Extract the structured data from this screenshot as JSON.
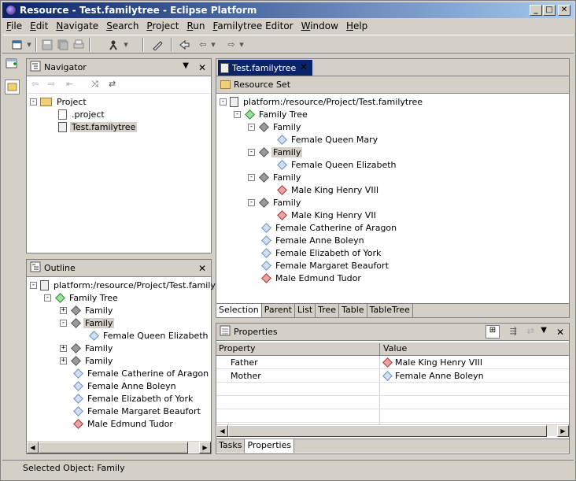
{
  "window": {
    "title": "Resource - Test.familytree - Eclipse Platform",
    "min": "_",
    "max": "□",
    "close": "✕"
  },
  "menu": [
    "File",
    "Edit",
    "Navigate",
    "Search",
    "Project",
    "Run",
    "Familytree Editor",
    "Window",
    "Help"
  ],
  "navigator": {
    "title": "Navigator",
    "items": [
      {
        "label": "Project"
      },
      {
        "label": ".project"
      },
      {
        "label": "Test.familytree"
      }
    ]
  },
  "outline": {
    "title": "Outline",
    "items": [
      {
        "label": "platform:/resource/Project/Test.familytr"
      },
      {
        "label": "Family Tree"
      },
      {
        "label": "Family"
      },
      {
        "label": "Family"
      },
      {
        "label": "Female Queen Elizabeth"
      },
      {
        "label": "Family"
      },
      {
        "label": "Family"
      },
      {
        "label": "Female Catherine of Aragon"
      },
      {
        "label": "Female Anne Boleyn"
      },
      {
        "label": "Female Elizabeth of York"
      },
      {
        "label": "Female Margaret Beaufort"
      },
      {
        "label": "Male Edmund Tudor"
      }
    ]
  },
  "editor": {
    "tab": "Test.familytree",
    "header": "Resource Set",
    "items": [
      {
        "label": "platform:/resource/Project/Test.familytree"
      },
      {
        "label": "Family Tree"
      },
      {
        "label": "Family"
      },
      {
        "label": "Female Queen Mary"
      },
      {
        "label": "Family"
      },
      {
        "label": "Female Queen Elizabeth"
      },
      {
        "label": "Family"
      },
      {
        "label": "Male King Henry VIII"
      },
      {
        "label": "Family"
      },
      {
        "label": "Male King Henry VII"
      },
      {
        "label": "Female Catherine of Aragon"
      },
      {
        "label": "Female Anne Boleyn"
      },
      {
        "label": "Female Elizabeth of York"
      },
      {
        "label": "Female Margaret Beaufort"
      },
      {
        "label": "Male Edmund Tudor"
      }
    ],
    "tabs": [
      "Selection",
      "Parent",
      "List",
      "Tree",
      "Table",
      "TableTree"
    ]
  },
  "properties": {
    "title": "Properties",
    "col_property": "Property",
    "col_value": "Value",
    "rows": [
      {
        "property": "Father",
        "value": "Male King Henry VIII"
      },
      {
        "property": "Mother",
        "value": "Female Anne Boleyn"
      }
    ],
    "tabs": [
      "Tasks",
      "Properties"
    ]
  },
  "status": "Selected Object: Family"
}
